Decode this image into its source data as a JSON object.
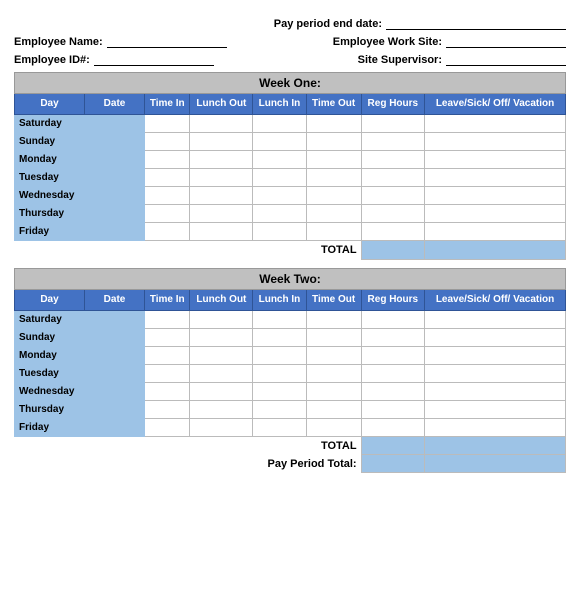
{
  "header": {
    "pay_period_label": "Pay period end date:",
    "employee_name_label": "Employee Name:",
    "employee_work_site_label": "Employee Work Site:",
    "employee_id_label": "Employee ID#:",
    "site_supervisor_label": "Site Supervisor:"
  },
  "week_one": {
    "title": "Week One:",
    "columns": [
      "Day",
      "Date",
      "Time In",
      "Lunch Out",
      "Lunch In",
      "Time Out",
      "Reg Hours",
      "Leave/Sick/ Off/ Vacation"
    ],
    "days": [
      "Saturday",
      "Sunday",
      "Monday",
      "Tuesday",
      "Wednesday",
      "Thursday",
      "Friday"
    ],
    "total_label": "TOTAL"
  },
  "week_two": {
    "title": "Week Two:",
    "columns": [
      "Day",
      "Date",
      "Time In",
      "Lunch Out",
      "Lunch In",
      "Time Out",
      "Reg Hours",
      "Leave/Sick/ Off/ Vacation"
    ],
    "days": [
      "Saturday",
      "Sunday",
      "Monday",
      "Tuesday",
      "Wednesday",
      "Thursday",
      "Friday"
    ],
    "total_label": "TOTAL"
  },
  "pay_period": {
    "total_label": "Pay Period Total:"
  }
}
